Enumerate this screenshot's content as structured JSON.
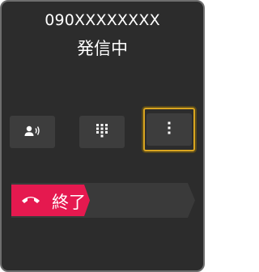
{
  "call": {
    "number": "090XXXXXXXX",
    "status": "発信中"
  },
  "controls": [
    {
      "icon": "speaker-icon"
    },
    {
      "icon": "keypad-icon"
    },
    {
      "icon": "more-options-icon",
      "highlighted": true
    }
  ],
  "end_call": {
    "label": "終了",
    "icon": "hang-up-icon",
    "color": "#e5194f"
  },
  "colors": {
    "background": "#2c2c2c",
    "button": "#3d3d3d",
    "highlight": "#d9a520"
  }
}
